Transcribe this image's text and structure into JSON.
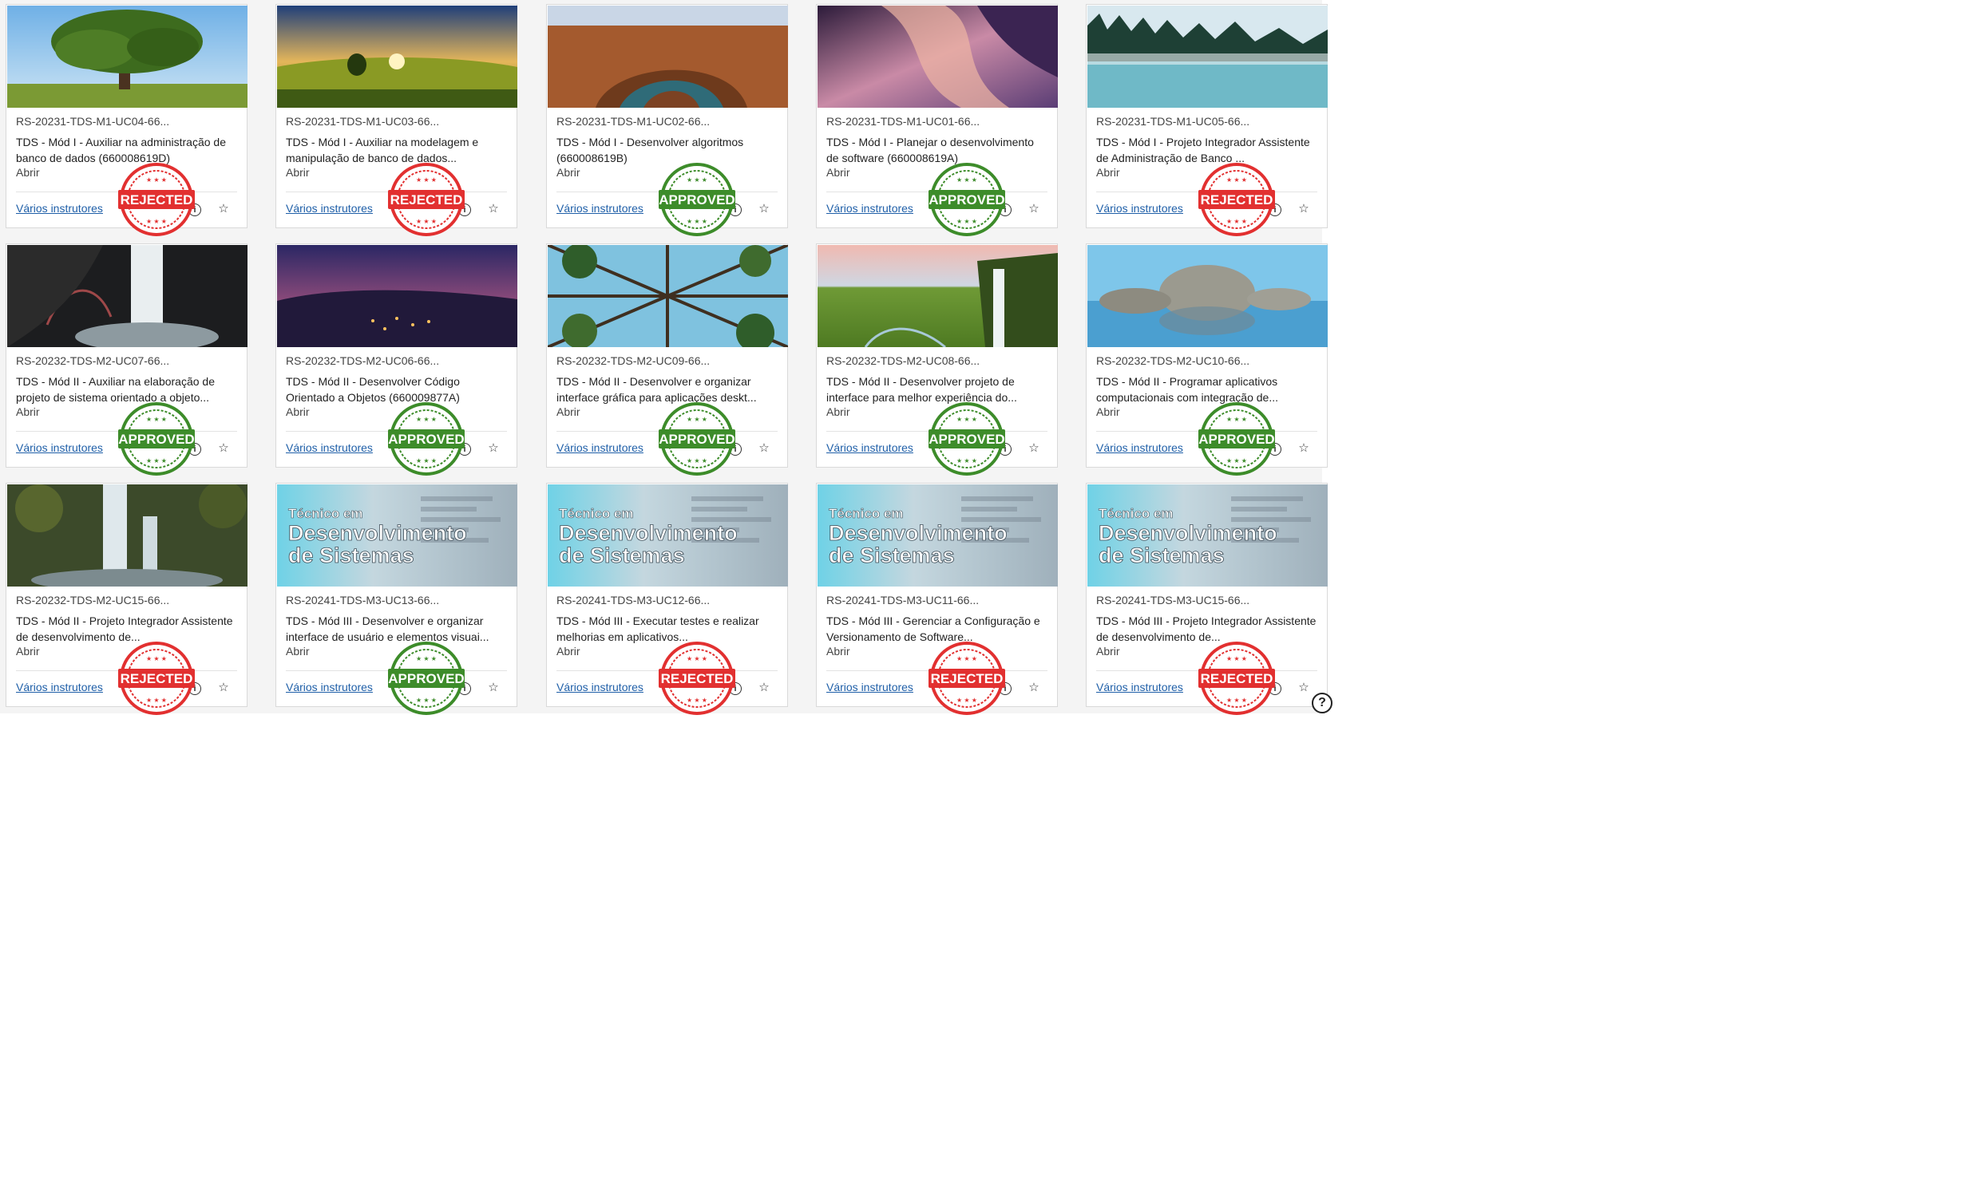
{
  "footer_instructors_label": "Vários instrutores",
  "open_label": "Abrir",
  "stamp_texts": {
    "approved": "APPROVED",
    "rejected": "REJECTED"
  },
  "colors": {
    "approved": "#3d8c2a",
    "rejected": "#e23030",
    "link": "#1f5fa8"
  },
  "cards": [
    {
      "code": "RS-20231-TDS-M1-UC04-66...",
      "title": "TDS - Mód I - Auxiliar na administração de banco de dados (660008619D)",
      "stamp": "rejected",
      "image": "tree"
    },
    {
      "code": "RS-20231-TDS-M1-UC03-66...",
      "title": "TDS - Mód I - Auxiliar na modelagem e manipulação de banco de dados...",
      "stamp": "rejected",
      "image": "sunset-field"
    },
    {
      "code": "RS-20231-TDS-M1-UC02-66...",
      "title": "TDS - Mód I - Desenvolver algoritmos (660008619B)",
      "stamp": "approved",
      "image": "canyon"
    },
    {
      "code": "RS-20231-TDS-M1-UC01-66...",
      "title": "TDS - Mód I - Planejar o desenvolvimento de software (660008619A)",
      "stamp": "approved",
      "image": "antelope-canyon"
    },
    {
      "code": "RS-20231-TDS-M1-UC05-66...",
      "title": "TDS - Mód I - Projeto Integrador Assistente de Administração de Banco ...",
      "stamp": "rejected",
      "image": "misty-lake"
    },
    {
      "code": "RS-20232-TDS-M2-UC07-66...",
      "title": "TDS - Mód II - Auxiliar na elaboração de projeto de sistema orientado a objeto...",
      "stamp": "approved",
      "image": "waterfall-cave"
    },
    {
      "code": "RS-20232-TDS-M2-UC06-66...",
      "title": "TDS - Mód II - Desenvolver Código Orientado a Objetos (660009877A)",
      "stamp": "approved",
      "image": "night-city"
    },
    {
      "code": "RS-20232-TDS-M2-UC09-66...",
      "title": "TDS - Mód II - Desenvolver e organizar interface gráfica para aplicações deskt...",
      "stamp": "approved",
      "image": "forest-canopy"
    },
    {
      "code": "RS-20232-TDS-M2-UC08-66...",
      "title": "TDS - Mód II - Desenvolver projeto de interface para melhor experiência do...",
      "stamp": "approved",
      "image": "green-waterfall"
    },
    {
      "code": "RS-20232-TDS-M2-UC10-66...",
      "title": "TDS - Mód II - Programar aplicativos computacionais com integração de...",
      "stamp": "approved",
      "image": "rocks-lake"
    },
    {
      "code": "RS-20232-TDS-M2-UC15-66...",
      "title": "TDS - Mód II - Projeto Integrador Assistente de desenvolvimento de...",
      "stamp": "rejected",
      "image": "forest-waterfall"
    },
    {
      "code": "RS-20241-TDS-M3-UC13-66...",
      "title": "TDS - Mód III - Desenvolver e organizar interface de usuário e elementos visuai...",
      "stamp": "approved",
      "image": "tds-banner",
      "banner": [
        "Técnico em",
        "Desenvolvimento",
        "de Sistemas"
      ]
    },
    {
      "code": "RS-20241-TDS-M3-UC12-66...",
      "title": "TDS - Mód III - Executar testes e realizar melhorias em aplicativos...",
      "stamp": "rejected",
      "image": "tds-banner",
      "banner": [
        "Técnico em",
        "Desenvolvimento",
        "de Sistemas"
      ]
    },
    {
      "code": "RS-20241-TDS-M3-UC11-66...",
      "title": "TDS - Mód III - Gerenciar a Configuração e Versionamento de Software...",
      "stamp": "rejected",
      "image": "tds-banner",
      "banner": [
        "Técnico em",
        "Desenvolvimento",
        "de Sistemas"
      ]
    },
    {
      "code": "RS-20241-TDS-M3-UC15-66...",
      "title": "TDS - Mód III - Projeto Integrador Assistente de desenvolvimento de...",
      "stamp": "rejected",
      "image": "tds-banner",
      "banner": [
        "Técnico em",
        "Desenvolvimento",
        "de Sistemas"
      ]
    }
  ]
}
